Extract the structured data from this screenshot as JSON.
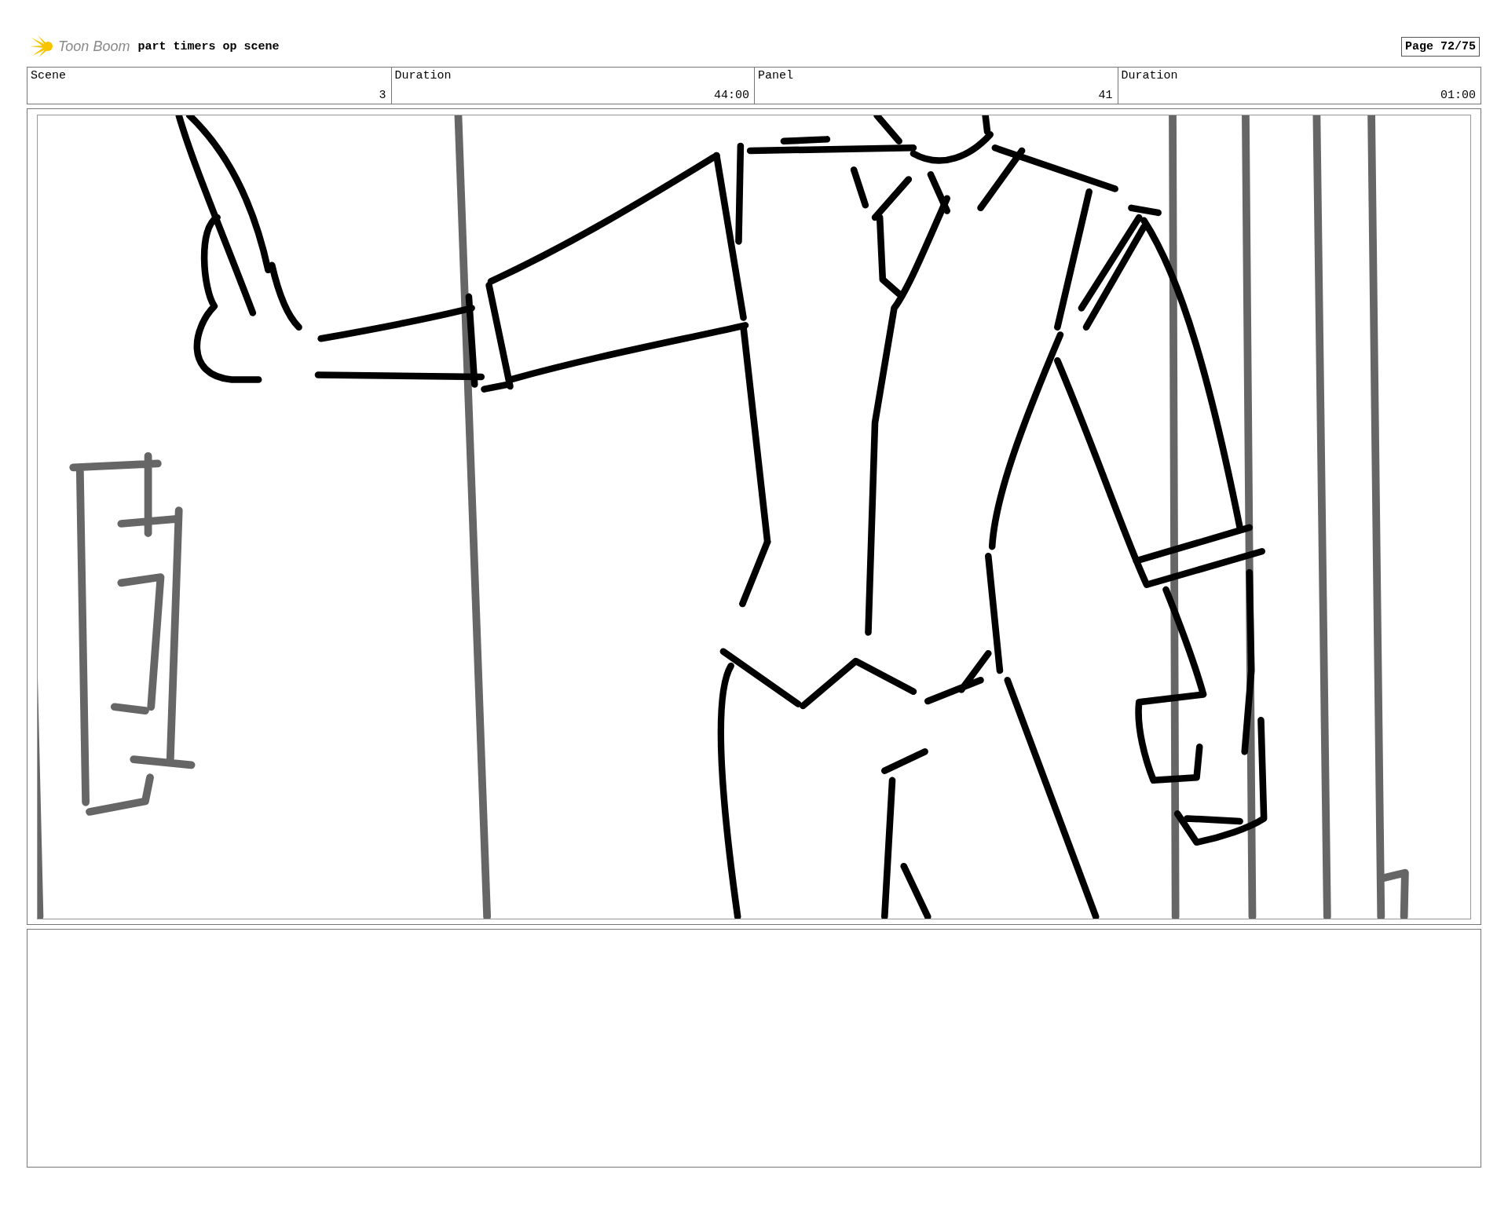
{
  "header": {
    "logo_text": "Toon Boom",
    "project_title": "part timers op scene",
    "page": "Page 72/75"
  },
  "info": [
    {
      "heading": "Scene",
      "entry": "3"
    },
    {
      "heading": "Duration",
      "entry": "44:00"
    },
    {
      "heading": "Panel",
      "entry": "41"
    },
    {
      "heading": "Duration",
      "entry": "01:00"
    }
  ]
}
